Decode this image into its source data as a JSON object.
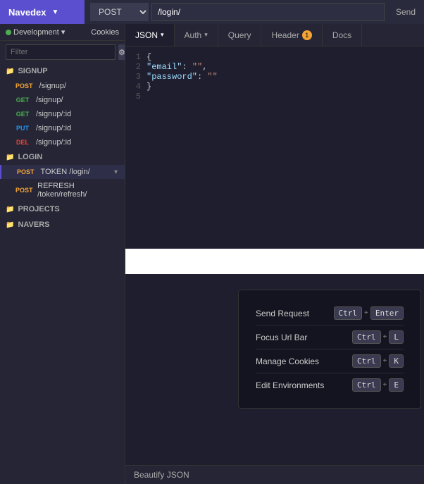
{
  "topbar": {
    "title": "Navedex",
    "method": "POST",
    "url": "/login/",
    "send_label": "Send"
  },
  "sidebar": {
    "env_label": "Development",
    "cookies_label": "Cookies",
    "filter_placeholder": "Filter",
    "sections": [
      {
        "name": "SIGNUP",
        "routes": [
          {
            "method": "POST",
            "path": "/signup/"
          },
          {
            "method": "GET",
            "path": "/signup/"
          },
          {
            "method": "GET",
            "path": "/signup/:id"
          },
          {
            "method": "PUT",
            "path": "/signup/:id"
          },
          {
            "method": "DEL",
            "path": "/signup/:id"
          }
        ]
      },
      {
        "name": "LOGIN",
        "routes": [
          {
            "method": "POST",
            "path": "TOKEN /login/",
            "active": true
          },
          {
            "method": "POST",
            "path": "REFRESH /token/refresh/"
          }
        ]
      },
      {
        "name": "PROJECTS",
        "routes": []
      },
      {
        "name": "NAVERS",
        "routes": []
      }
    ]
  },
  "tabs": [
    {
      "label": "JSON",
      "active": true,
      "has_arrow": true
    },
    {
      "label": "Auth",
      "has_arrow": true
    },
    {
      "label": "Query"
    },
    {
      "label": "Header",
      "badge": "1"
    },
    {
      "label": "Docs"
    }
  ],
  "code": {
    "lines": [
      {
        "num": "1",
        "content": "{"
      },
      {
        "num": "2",
        "content": "  \"email\": \"\","
      },
      {
        "num": "3",
        "content": "  \"password\": \"\""
      },
      {
        "num": "4",
        "content": "}"
      },
      {
        "num": "5",
        "content": ""
      }
    ]
  },
  "bottom_bar": {
    "beautify_label": "Beautify JSON"
  },
  "shortcuts": [
    {
      "label": "Send Request",
      "keys": [
        "Ctrl",
        "+",
        "Enter"
      ]
    },
    {
      "label": "Focus Url Bar",
      "keys": [
        "Ctrl",
        "+",
        "L"
      ]
    },
    {
      "label": "Manage Cookies",
      "keys": [
        "Ctrl",
        "+",
        "K"
      ]
    },
    {
      "label": "Edit Environments",
      "keys": [
        "Ctrl",
        "+",
        "E"
      ]
    }
  ]
}
